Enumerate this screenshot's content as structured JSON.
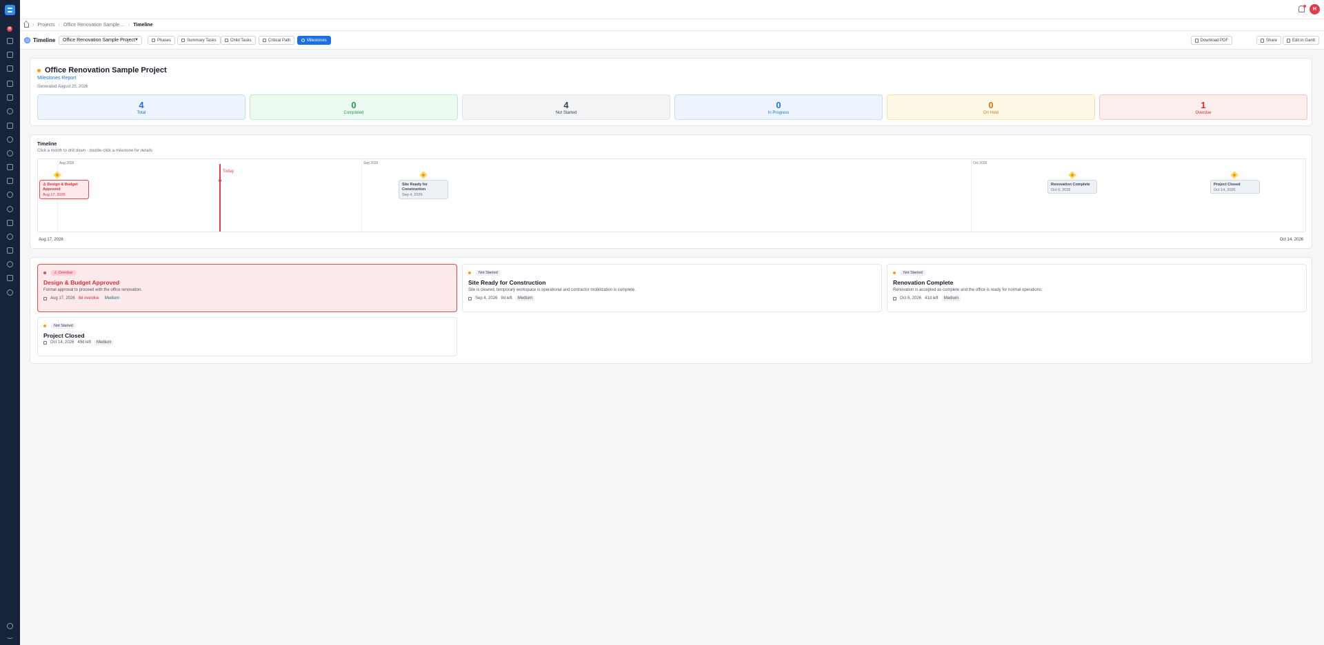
{
  "topbar": {
    "avatar_initial": "H"
  },
  "sidebar": {
    "badge": "H"
  },
  "breadcrumb": {
    "item1": "Projects",
    "item2": "Office Renovation Sample ...",
    "current": "Timeline"
  },
  "toolbar": {
    "title": "Timeline",
    "project_select": "Office Renovation Sample Project",
    "tabs": [
      "Phases",
      "Summary Tasks",
      "Child Tasks",
      "Critical Path",
      "Milestones"
    ],
    "active_tab": "Milestones",
    "download": "Download PDF",
    "share": "Share",
    "edit": "Edit in Gantt"
  },
  "report": {
    "project": "Office Renovation Sample Project",
    "subtitle": "Milestones Report",
    "generated": "Generated August 25, 2026",
    "stats": [
      {
        "value": "4",
        "label": "Total",
        "color": "#1d6fe3"
      },
      {
        "value": "0",
        "label": "Completed",
        "color": "#16a34a"
      },
      {
        "value": "4",
        "label": "Not Started",
        "color": "#374151"
      },
      {
        "value": "0",
        "label": "In Progress",
        "color": "#1d6fe3"
      },
      {
        "value": "0",
        "label": "On Hold",
        "color": "#d97706"
      },
      {
        "value": "1",
        "label": "Overdue",
        "color": "#dc2626"
      }
    ]
  },
  "timeline": {
    "title": "Timeline",
    "hint": "Click a month to drill down · double-click a milestone for details",
    "months": [
      "Aug 2026",
      "Sep 2026",
      "Oct 2026"
    ],
    "today_label": "Today",
    "start_label": "Aug 17, 2026",
    "end_label": "Oct 14, 2026",
    "milestones": [
      {
        "name": "Design & Budget Approved",
        "date": "Aug 17, 2026",
        "status": "overdue"
      },
      {
        "name": "Site Ready for Construction",
        "date": "Sep 4, 2026",
        "status": "not-started"
      },
      {
        "name": "Renovation Complete",
        "date": "Oct 6, 2026",
        "status": "not-started"
      },
      {
        "name": "Project Closed",
        "date": "Oct 14, 2026",
        "status": "not-started"
      }
    ]
  },
  "cards": [
    {
      "badge": "Overdue",
      "name": "Design & Budget Approved",
      "desc": "Formal approval to proceed with the office renovation.",
      "date": "Aug 17, 2026",
      "left": "8d overdue",
      "priority": "Medium"
    },
    {
      "badge": "Not Started",
      "name": "Site Ready for Construction",
      "desc": "Site is cleared, temporary workspace is operational and contractor mobilization is complete.",
      "date": "Sep 4, 2026",
      "left": "9d left",
      "priority": "Medium"
    },
    {
      "badge": "Not Started",
      "name": "Renovation Complete",
      "desc": "Renovation is accepted as complete and the office is ready for normal operations.",
      "date": "Oct 6, 2026",
      "left": "41d left",
      "priority": "Medium"
    },
    {
      "badge": "Not Started",
      "name": "Project Closed",
      "desc": "",
      "date": "Oct 14, 2026",
      "left": "49d left",
      "priority": "Medium"
    }
  ]
}
